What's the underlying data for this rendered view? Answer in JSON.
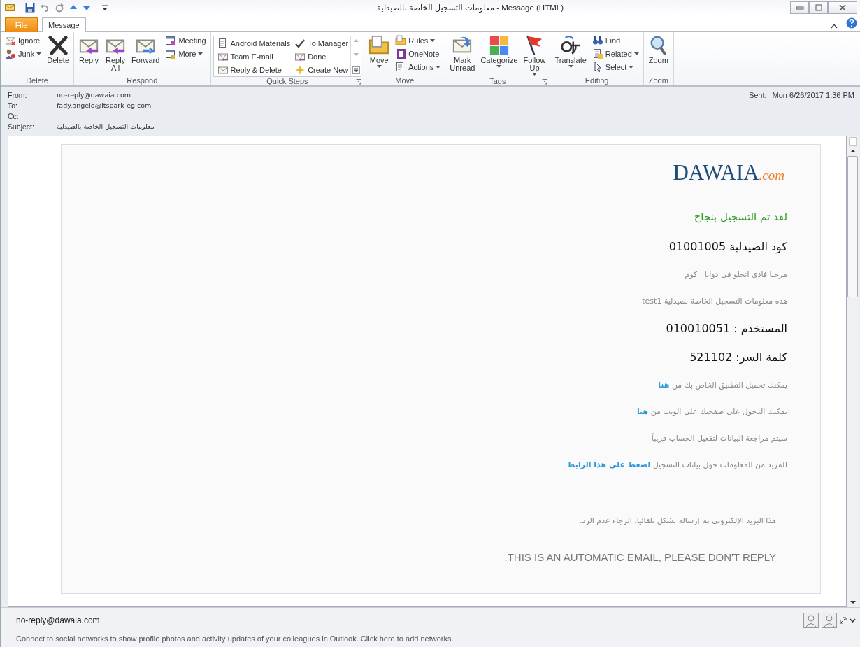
{
  "window": {
    "title": "معلومات التسجيل الخاصة بالصيدلية - Message (HTML)"
  },
  "tabs": [
    {
      "label": "File",
      "selected": false,
      "kind": "file"
    },
    {
      "label": "Message",
      "selected": true,
      "kind": "tab"
    }
  ],
  "ribbon": {
    "groups": [
      {
        "label": "Delete",
        "kind": "buttons",
        "launcher": false,
        "columns": [
          [
            {
              "label": "Ignore",
              "dropdown": false
            },
            {
              "label": "Junk",
              "dropdown": true
            }
          ],
          [
            {
              "label": "Delete",
              "dropdown": false
            }
          ]
        ]
      },
      {
        "label": "Respond",
        "kind": "buttons",
        "launcher": false,
        "columns": [
          [
            {
              "label": "Reply",
              "dropdown": false
            }
          ],
          [
            {
              "label": "Reply All",
              "dropdown": false
            }
          ],
          [
            {
              "label": "Forward",
              "dropdown": false
            }
          ],
          [
            {
              "label": "Meeting",
              "dropdown": false
            },
            {
              "label": "More",
              "dropdown": true
            }
          ]
        ]
      },
      {
        "label": "Quick Steps",
        "kind": "gallery",
        "launcher": true,
        "columns": [
          [
            {
              "label": "Android Materials"
            },
            {
              "label": "Team E-mail"
            },
            {
              "label": "Reply & Delete"
            }
          ],
          [
            {
              "label": "To Manager"
            },
            {
              "label": "Done"
            },
            {
              "label": "Create New"
            }
          ]
        ]
      },
      {
        "label": "Move",
        "kind": "buttons",
        "launcher": false,
        "columns": [
          [
            {
              "label": "Move",
              "dropdown": true
            }
          ],
          [
            {
              "label": "Rules",
              "dropdown": true
            },
            {
              "label": "OneNote",
              "dropdown": false
            },
            {
              "label": "Actions",
              "dropdown": true
            }
          ]
        ]
      },
      {
        "label": "Tags",
        "kind": "buttons",
        "launcher": true,
        "columns": [
          [
            {
              "label": "Mark Unread",
              "dropdown": false
            }
          ],
          [
            {
              "label": "Categorize",
              "dropdown": true
            }
          ],
          [
            {
              "label": "Follow Up",
              "dropdown": true
            }
          ]
        ]
      },
      {
        "label": "Editing",
        "kind": "buttons",
        "launcher": false,
        "columns": [
          [
            {
              "label": "Translate",
              "dropdown": true
            }
          ],
          [
            {
              "label": "Find",
              "dropdown": false
            },
            {
              "label": "Related",
              "dropdown": true
            },
            {
              "label": "Select",
              "dropdown": true
            }
          ]
        ]
      },
      {
        "label": "Zoom",
        "kind": "buttons",
        "launcher": false,
        "columns": [
          [
            {
              "label": "Zoom",
              "dropdown": false
            }
          ]
        ]
      }
    ]
  },
  "header": {
    "fields": [
      {
        "label": "From:",
        "value": "no-reply@dawaia.com"
      },
      {
        "label": "To:",
        "value": "fady.angelo@itspark-eg.com"
      },
      {
        "label": "Cc:"
      },
      {
        "label": "Subject:",
        "value": "معلومات التسجيل الخاصة بالصيدلية"
      }
    ],
    "sent": {
      "label": "Sent:",
      "value": "Mon 6/26/2017 1:36 PM"
    }
  },
  "email": {
    "logo": {
      "name": "DAWAIA",
      "suffix": ".com"
    },
    "lines": [
      {
        "kind": "success",
        "text": "لقد تم التسجيل بنجاح"
      },
      {
        "kind": "heading",
        "text": "كود الصيدلية 01001005"
      },
      {
        "kind": "muted",
        "text": "مرحبا فادى انجلو فى دوايا . كوم"
      },
      {
        "kind": "muted",
        "text": "هذه معلومات التسجيل الخاصة بصيدلية test1"
      },
      {
        "kind": "heading",
        "text": "المستخدم : 010010051"
      },
      {
        "kind": "heading",
        "text": "كلمة السر: 521102"
      },
      {
        "kind": "muted",
        "text": "يمكنك تحميل التطبيق الخاص بك من",
        "link": "هنا"
      },
      {
        "kind": "muted",
        "text": "يمكنك الدخول على صفحتك على الويب من",
        "link": "هنا"
      },
      {
        "kind": "muted",
        "text": "سيتم مراجعة البيانات لتفعيل الحساب قريباً"
      },
      {
        "kind": "muted",
        "text": "للمزيد من المعلومات حول بيانات التسجيل",
        "link": "اضغط علي هذا الرابط"
      },
      {
        "kind": "notice",
        "text": "هذا البريد الإلكتروني تم إرساله بشكل تلقائيا، الرجاء عدم الرد."
      },
      {
        "kind": "english",
        "text": ".THIS IS AN AUTOMATIC EMAIL, PLEASE DON'T REPLY"
      }
    ]
  },
  "people_pane": {
    "name": "no-reply@dawaia.com",
    "message": "Connect to social networks to show profile photos and activity updates of your colleagues in Outlook. Click here to add networks."
  }
}
